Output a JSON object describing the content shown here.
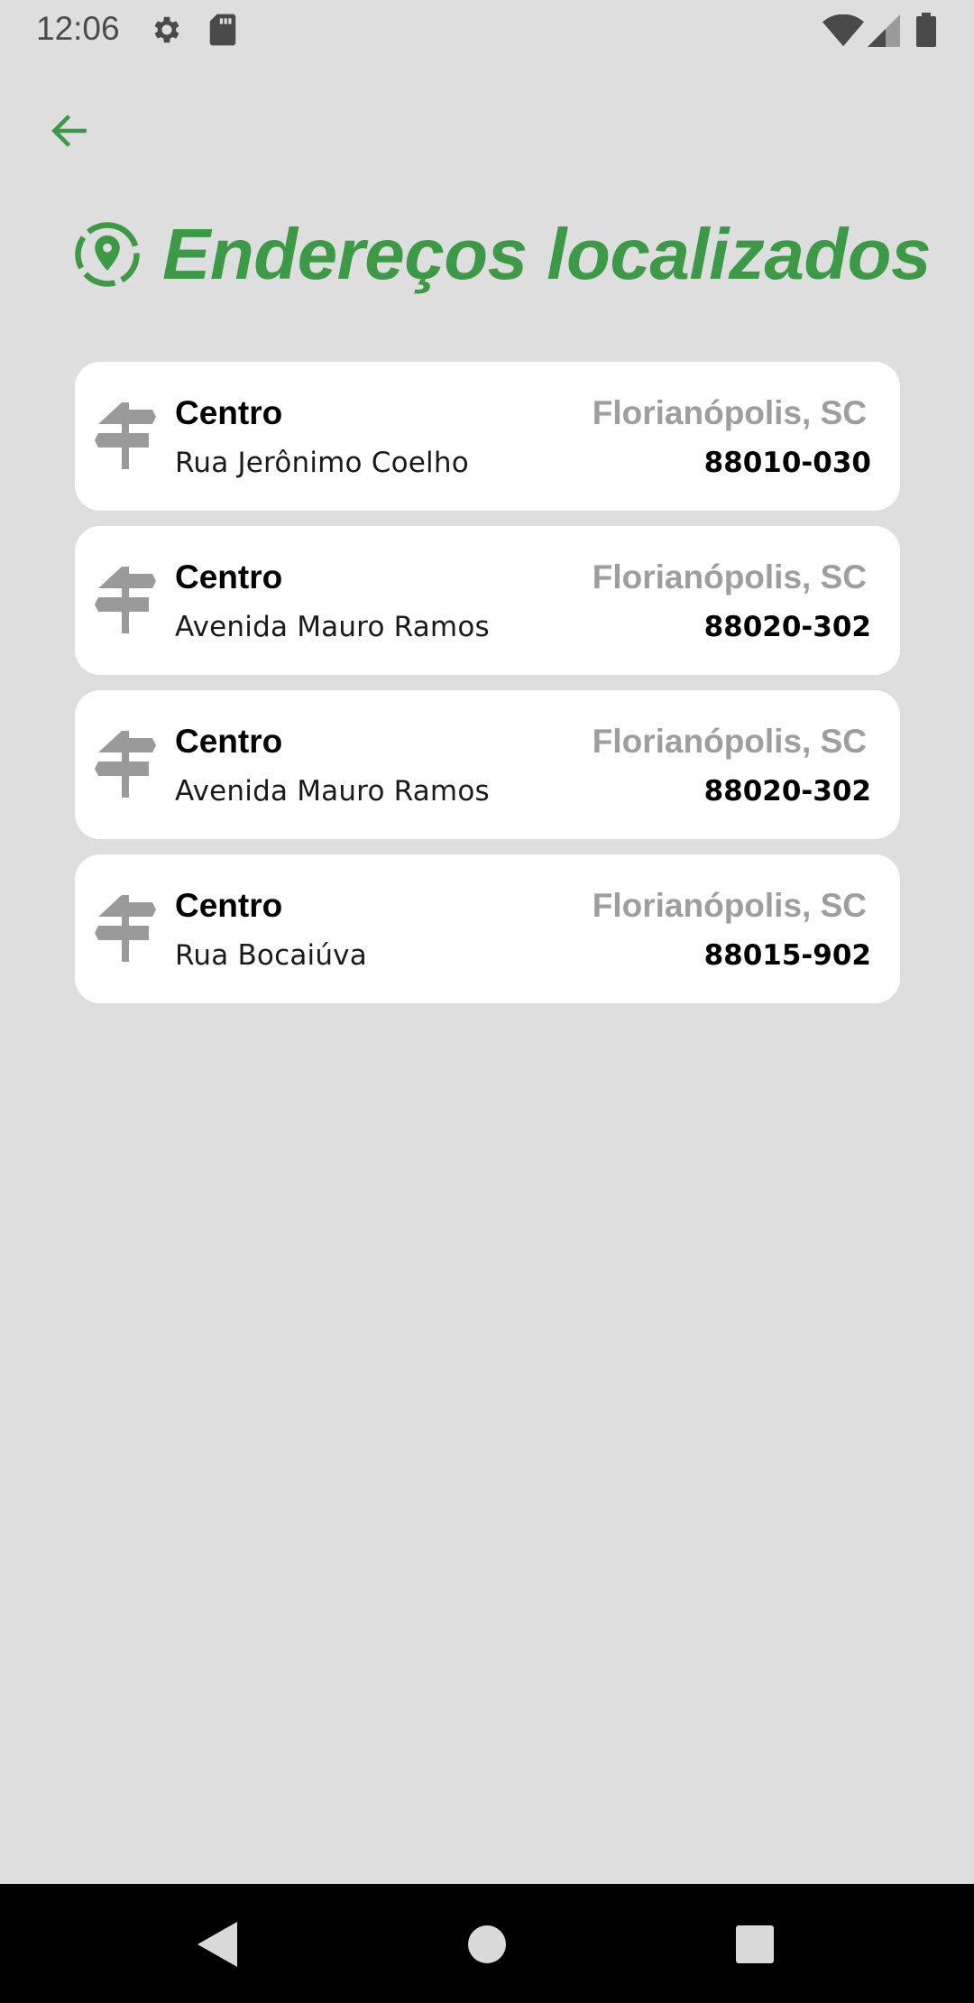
{
  "status_bar": {
    "time": "12:06",
    "icons": [
      "settings-icon",
      "sd-card-icon",
      "wifi-icon",
      "signal-icon",
      "battery-icon"
    ]
  },
  "header": {
    "title": "Endereços localizados",
    "icon": "location-pin-icon",
    "accent_color": "#3c9a47"
  },
  "addresses": [
    {
      "neighborhood": "Centro",
      "street": "Rua Jerônimo Coelho",
      "city": "Florianópolis, SC",
      "cep": "88010-030"
    },
    {
      "neighborhood": "Centro",
      "street": "Avenida Mauro Ramos",
      "city": "Florianópolis, SC",
      "cep": "88020-302"
    },
    {
      "neighborhood": "Centro",
      "street": "Avenida Mauro Ramos",
      "city": "Florianópolis, SC",
      "cep": "88020-302"
    },
    {
      "neighborhood": "Centro",
      "street": "Rua Bocaiúva",
      "city": "Florianópolis, SC",
      "cep": "88015-902"
    }
  ],
  "navigation": {
    "icons": [
      "back-triangle-icon",
      "home-circle-icon",
      "recents-square-icon"
    ]
  }
}
